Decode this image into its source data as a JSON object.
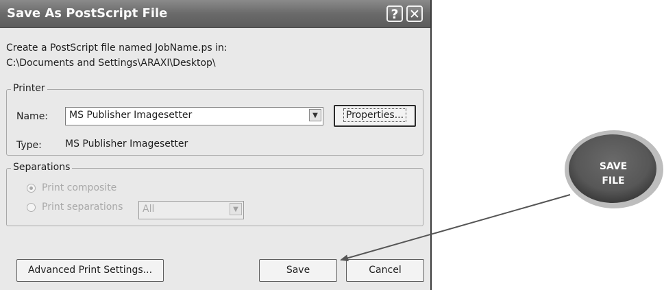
{
  "dialog": {
    "title": "Save As PostScript File",
    "help_button": "?",
    "close_button": "✕",
    "description_line1": "Create a PostScript file named JobName.ps in:",
    "description_line2": "C:\\Documents and Settings\\ARAXI\\Desktop\\"
  },
  "printer": {
    "group_label": "Printer",
    "name_label": "Name:",
    "name_value": "MS Publisher Imagesetter",
    "properties_button": "Properties...",
    "type_label": "Type:",
    "type_value": "MS Publisher Imagesetter"
  },
  "separations": {
    "group_label": "Separations",
    "print_composite": "Print composite",
    "print_separations": "Print separations",
    "separations_value": "All",
    "selected": "Print composite"
  },
  "footer": {
    "advanced_button": "Advanced Print Settings...",
    "save_button": "Save",
    "cancel_button": "Cancel"
  },
  "callout": {
    "line1": "SAVE",
    "line2": "FILE"
  },
  "colors": {
    "titlebar": "#6a6a6a",
    "dialog_bg": "#e9e9e9",
    "callout": "#5a5a5a",
    "arrow": "#555555"
  }
}
